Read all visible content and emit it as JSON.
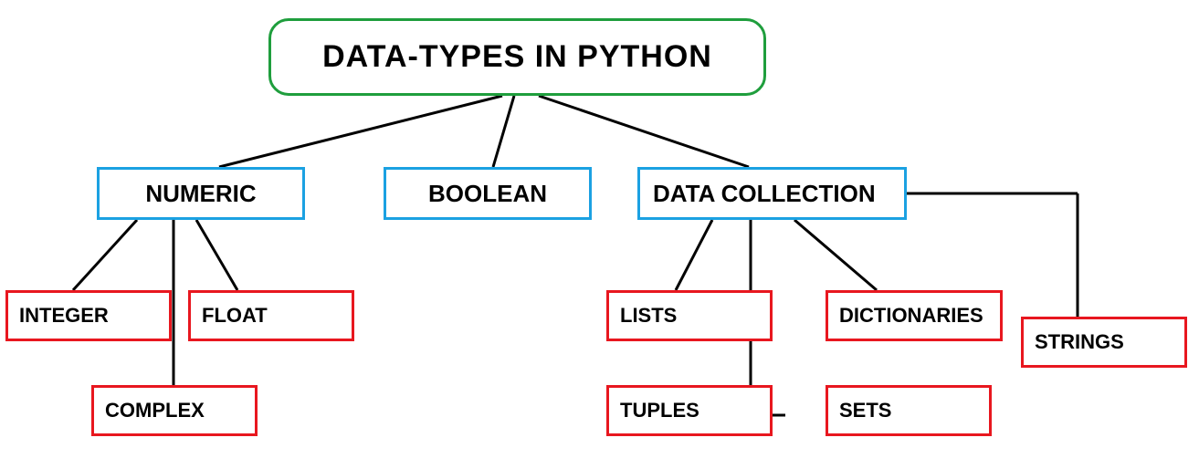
{
  "root": {
    "title": "DATA-TYPES IN PYTHON"
  },
  "categories": {
    "numeric": "NUMERIC",
    "boolean": "BOOLEAN",
    "data_collection": "DATA COLLECTION"
  },
  "numeric_children": {
    "integer": "INTEGER",
    "float": "FLOAT",
    "complex": "COMPLEX"
  },
  "collection_children": {
    "lists": "LISTS",
    "dictionaries": "DICTIONARIES",
    "strings": "STRINGS",
    "tuples": "TUPLES",
    "sets": "SETS"
  }
}
